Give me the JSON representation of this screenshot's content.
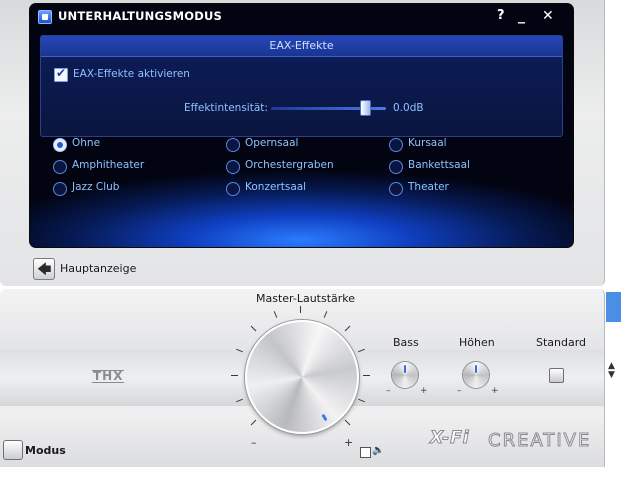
{
  "window": {
    "title": "UNTERHALTUNGSMODUS",
    "help": "?",
    "minimize": "_",
    "close": "✕"
  },
  "eax": {
    "title": "EAX-Effekte",
    "enable_label": "EAX-Effekte aktivieren",
    "enabled": true,
    "intensity_label": "Effektintensität:",
    "intensity_value": "0.0dB"
  },
  "presets": [
    {
      "label": "Ohne",
      "selected": true
    },
    {
      "label": "Opernsaal",
      "selected": false
    },
    {
      "label": "Kursaal",
      "selected": false
    },
    {
      "label": "Amphitheater",
      "selected": false
    },
    {
      "label": "Orchestergraben",
      "selected": false
    },
    {
      "label": "Bankettsaal",
      "selected": false
    },
    {
      "label": "Jazz Club",
      "selected": false
    },
    {
      "label": "Konzertsaal",
      "selected": false
    },
    {
      "label": "Theater",
      "selected": false
    }
  ],
  "nav": {
    "back_label": "Hauptanzeige",
    "back_icon": "arrow-left-icon"
  },
  "console": {
    "master_label": "Master-Lautstärke",
    "minus": "–",
    "plus": "+",
    "thx": "THX",
    "bass_label": "Bass",
    "treble_label": "Höhen",
    "standard_label": "Standard",
    "mode_label": "Modus",
    "xfi": "X-Fi",
    "brand": "CREATIVE"
  },
  "colors": {
    "accent": "#2a55d6",
    "label_blue": "#8ec2ff",
    "indicator": "#3f7be8"
  }
}
